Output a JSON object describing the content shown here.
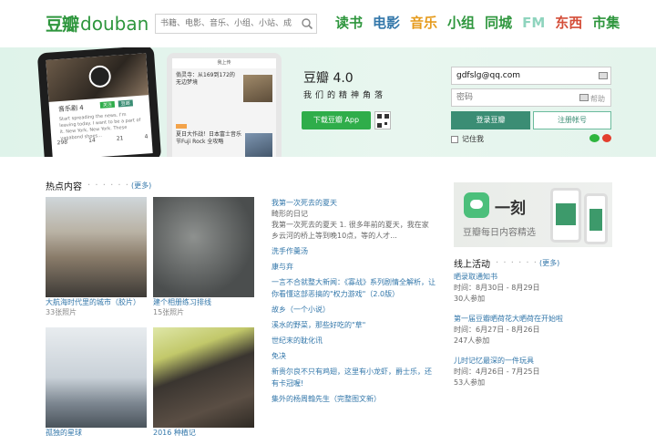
{
  "header": {
    "logo_cn": "豆瓣",
    "logo_en": "douban",
    "search_placeholder": "书籍、电影、音乐、小组、小站、成员",
    "nav": [
      {
        "label": "读书",
        "color": "#2e963d"
      },
      {
        "label": "电影",
        "color": "#3377aa"
      },
      {
        "label": "音乐",
        "color": "#e69b1c"
      },
      {
        "label": "小组",
        "color": "#2e963d"
      },
      {
        "label": "同城",
        "color": "#2e963d"
      },
      {
        "label": "FM",
        "color": "#8fd4be"
      },
      {
        "label": "东西",
        "color": "#d44d38"
      },
      {
        "label": "市集",
        "color": "#2e963d"
      }
    ]
  },
  "hero": {
    "phone1": {
      "profile_name": "音乐剧 4",
      "chip_a": "关注",
      "chip_b": "豆邮",
      "desc": "Start spreading the news. I'm leaving today. I want to be a part of it. New York, New York. These vagabond shoes...",
      "stats": [
        "298",
        "14",
        "21",
        "4"
      ]
    },
    "phone2": {
      "bar": "我上传",
      "feed1": "倘灵寺：从169到172的无边梦境",
      "feed2": "夏日大作战！日本富士音乐节Fuji Rock 全攻略"
    },
    "app_title": "豆瓣 4.0",
    "app_slogan": "我们的精神角落",
    "download_label": "下载豆瓣 App"
  },
  "login": {
    "email_value": "gdfslg@qq.com",
    "password_placeholder": "密码",
    "help_label": "帮助",
    "login_label": "登录豆瓣",
    "register_label": "注册帐号",
    "remember_label": "记住我"
  },
  "hot": {
    "title": "热点内容",
    "dots": "· · · · · ·",
    "more": "(更多)",
    "albums": [
      {
        "caption": "大航海时代里的城市（胶片）",
        "count": "33张照片"
      },
      {
        "caption": "建个相册练习排线",
        "count": "15张照片"
      },
      {
        "caption": "孤独的星球",
        "count": "36张照片"
      },
      {
        "caption": "2016 种植记",
        "count": "225张照片"
      }
    ],
    "articles": {
      "first_title": "我第一次死去的夏天",
      "first_sub": "畸形的日记",
      "first_summary": "我第一次死去的夏天 1. 很多年前的夏天，我在家乡云河的桥上等到晚10点，等的人才...",
      "items": [
        "洗手作羹汤",
        "康与弃",
        "一言不合就整大新闻：《寡战》系列剧情全解析，让你看懂这部恶搞的\"权力游戏\"（2.0版）",
        "故乡（一个小说）",
        "溪水的野菜，那些好吃的\"草\"",
        "世纪末的耽化讯",
        "免决",
        "新贵尔良不只有鸡翅，这里有小龙虾，爵士乐，还有卡冠喔!",
        "集外的杨周翰先生（完整图文新）"
      ]
    }
  },
  "ad": {
    "title": "一刻",
    "subtitle": "豆瓣每日内容精选"
  },
  "events": {
    "title": "线上活动",
    "dots": "· · · · · ·",
    "more": "(更多)",
    "items": [
      {
        "title": "晒录取通知书",
        "date": "时间：8月30日 - 8月29日",
        "count": "30人参加"
      },
      {
        "title": "第一届豆瓣晒荷花大晒荷在开始啦",
        "date": "时间：6月27日 - 8月26日",
        "count": "247人参加"
      },
      {
        "title": "儿时记忆最深的一件玩具",
        "date": "时间：4月26日 - 7月25日",
        "count": "53人参加"
      }
    ]
  }
}
